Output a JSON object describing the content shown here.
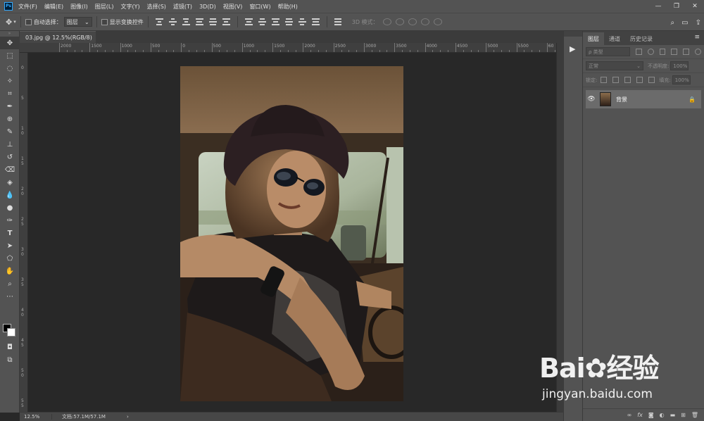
{
  "app": {
    "logo": "Ps"
  },
  "menu": [
    "文件(F)",
    "编辑(E)",
    "图像(I)",
    "图层(L)",
    "文字(Y)",
    "选择(S)",
    "滤镜(T)",
    "3D(D)",
    "视图(V)",
    "窗口(W)",
    "帮助(H)"
  ],
  "window_controls": {
    "minimize": "—",
    "restore": "❐",
    "close": "✕"
  },
  "options": {
    "auto_select_label": "自动选择：",
    "auto_select_value": "图层",
    "transform_label": "显示变换控件",
    "mode_3d_label": "3D 模式："
  },
  "document": {
    "tab_title": "03.jpg @ 12.5%(RGB/8)",
    "close_glyph": "×"
  },
  "ruler": {
    "top": [
      "2000",
      "1500",
      "1000",
      "500",
      "0",
      "500",
      "1000",
      "1500",
      "2000",
      "2500",
      "3000",
      "3500",
      "4000",
      "4500",
      "5000",
      "5500",
      "60"
    ],
    "left": [
      "0",
      "5",
      "1\n0",
      "1\n5",
      "2\n0",
      "2\n5",
      "3\n0",
      "3\n5",
      "4\n0",
      "4\n5",
      "5\n0",
      "5\n5"
    ]
  },
  "status": {
    "zoom": "12.5%",
    "doc_info": "文档:57.1M/57.1M",
    "arrow": "›"
  },
  "panels": {
    "tabs": [
      "图层",
      "通道",
      "历史记录"
    ],
    "active_tab": 0,
    "kind_placeholder": "ρ 类型",
    "blend_mode": "正常",
    "opacity_label": "不透明度:",
    "opacity_value": "100%",
    "lock_label": "锁定:",
    "fill_label": "填充:",
    "fill_value": "100%",
    "layer": {
      "name": "背景",
      "visible": true,
      "locked": true
    }
  },
  "watermark": {
    "brand": "Bai✿经验",
    "url": "jingyan.baidu.com"
  },
  "colors": {
    "foreground": "#000000",
    "background": "#ffffff",
    "panel_bg": "#535353",
    "canvas_bg": "#282828"
  }
}
